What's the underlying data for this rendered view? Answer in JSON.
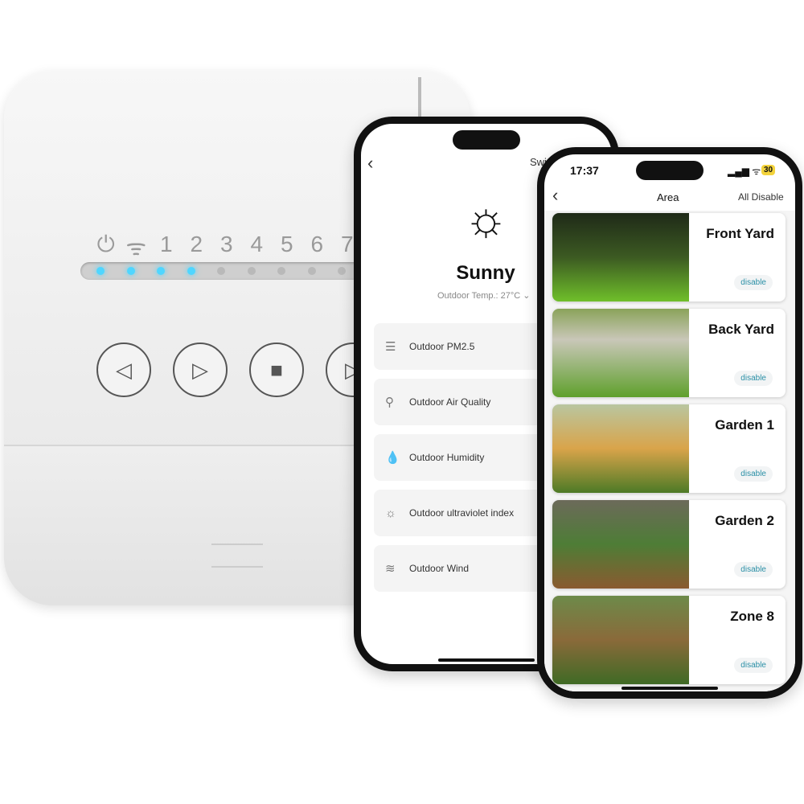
{
  "device": {
    "labels": [
      "⏻",
      "wifi",
      "1",
      "2",
      "3",
      "4",
      "5",
      "6",
      "7"
    ],
    "leds_on": [
      true,
      true,
      true,
      true,
      false,
      false,
      false,
      false,
      false
    ],
    "buttons": [
      {
        "icon": "previous-icon",
        "glyph": "◁"
      },
      {
        "icon": "play-icon",
        "glyph": "▷"
      },
      {
        "icon": "stop-icon",
        "glyph": "■"
      },
      {
        "icon": "next-icon",
        "glyph": "▷"
      }
    ],
    "led_color": "#4fd6ff"
  },
  "weather_screen": {
    "header_partial": "Swi",
    "condition": "Sunny",
    "temperature": "Outdoor Temp.: 27°C ⌄",
    "rows": [
      {
        "icon": "pm25-icon",
        "glyph": "☰",
        "label": "Outdoor PM2.5"
      },
      {
        "icon": "sprout-icon",
        "glyph": "⚲",
        "label": "Outdoor Air Quality"
      },
      {
        "icon": "droplet-icon",
        "glyph": "💧",
        "label": "Outdoor Humidity"
      },
      {
        "icon": "sun-icon",
        "glyph": "☼",
        "label": "Outdoor ultraviolet index"
      },
      {
        "icon": "wind-icon",
        "glyph": "≋",
        "label": "Outdoor Wind"
      }
    ]
  },
  "area_screen": {
    "time": "17:37",
    "battery": "30",
    "title": "Area",
    "action": "All Disable",
    "zones": [
      {
        "name": "Front Yard",
        "button": "disable"
      },
      {
        "name": "Back Yard",
        "button": "disable"
      },
      {
        "name": "Garden 1",
        "button": "disable"
      },
      {
        "name": "Garden 2",
        "button": "disable"
      },
      {
        "name": "Zone 8",
        "button": "disable"
      }
    ],
    "accent": "#2a8fa6"
  }
}
